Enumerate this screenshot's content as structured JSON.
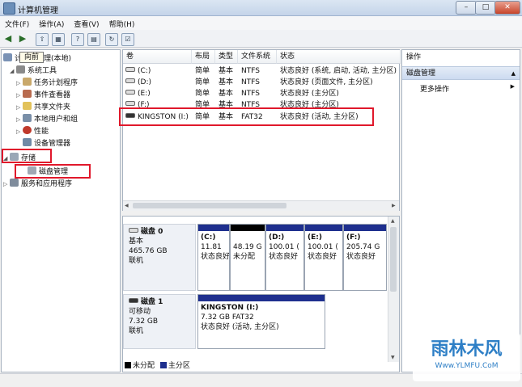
{
  "window": {
    "title": "计算机管理",
    "minimize": "–",
    "maximize": "□",
    "close": "✕"
  },
  "menu": [
    "文件(F)",
    "操作(A)",
    "查看(V)",
    "帮助(H)"
  ],
  "tooltip": "向前",
  "tree": {
    "root": "计算机管理(本地)",
    "system_tools": "系统工具",
    "task_scheduler": "任务计划程序",
    "event_viewer": "事件查看器",
    "shared_folders": "共享文件夹",
    "local_users": "本地用户和组",
    "performance": "性能",
    "device_manager": "设备管理器",
    "storage": "存储",
    "disk_management": "磁盘管理",
    "services_apps": "服务和应用程序"
  },
  "volume_table": {
    "columns": [
      "卷",
      "布局",
      "类型",
      "文件系统",
      "状态"
    ],
    "rows": [
      {
        "volume": "(C:)",
        "layout": "简单",
        "type": "基本",
        "fs": "NTFS",
        "status": "状态良好 (系统, 启动, 活动, 主分区)"
      },
      {
        "volume": "(D:)",
        "layout": "简单",
        "type": "基本",
        "fs": "NTFS",
        "status": "状态良好 (页面文件, 主分区)"
      },
      {
        "volume": "(E:)",
        "layout": "简单",
        "type": "基本",
        "fs": "NTFS",
        "status": "状态良好 (主分区)"
      },
      {
        "volume": "(F:)",
        "layout": "简单",
        "type": "基本",
        "fs": "NTFS",
        "status": "状态良好 (主分区)"
      },
      {
        "volume": "KINGSTON (I:)",
        "layout": "简单",
        "type": "基本",
        "fs": "FAT32",
        "status": "状态良好 (活动, 主分区)"
      }
    ]
  },
  "disk0": {
    "name": "磁盘 0",
    "kind": "基本",
    "size": "465.76 GB",
    "state": "联机",
    "partitions": [
      {
        "label": "(C:)",
        "size": "11.81",
        "status": "状态良好"
      },
      {
        "label": "",
        "size": "48.19 G",
        "status": "未分配"
      },
      {
        "label": "(D:)",
        "size": "100.01 (",
        "status": "状态良好"
      },
      {
        "label": "(E:)",
        "size": "100.01 (",
        "status": "状态良好"
      },
      {
        "label": "(F:)",
        "size": "205.74 G",
        "status": "状态良好"
      }
    ]
  },
  "disk1": {
    "name": "磁盘 1",
    "kind": "可移动",
    "size": "7.32 GB",
    "state": "联机",
    "partition": {
      "label": "KINGSTON  (I:)",
      "size": "7.32 GB FAT32",
      "status": "状态良好 (活动, 主分区)"
    }
  },
  "legend": {
    "unallocated": "未分配",
    "primary": "主分区"
  },
  "actions": {
    "title": "操作",
    "section": "磁盘管理",
    "more": "更多操作"
  },
  "watermark": {
    "brand": "雨林木风",
    "url": "Www.YLMFU.CoM"
  },
  "colors": {
    "primary_partition": "#1e2f8e",
    "unallocated": "#000000",
    "highlight": "#e0182b"
  }
}
